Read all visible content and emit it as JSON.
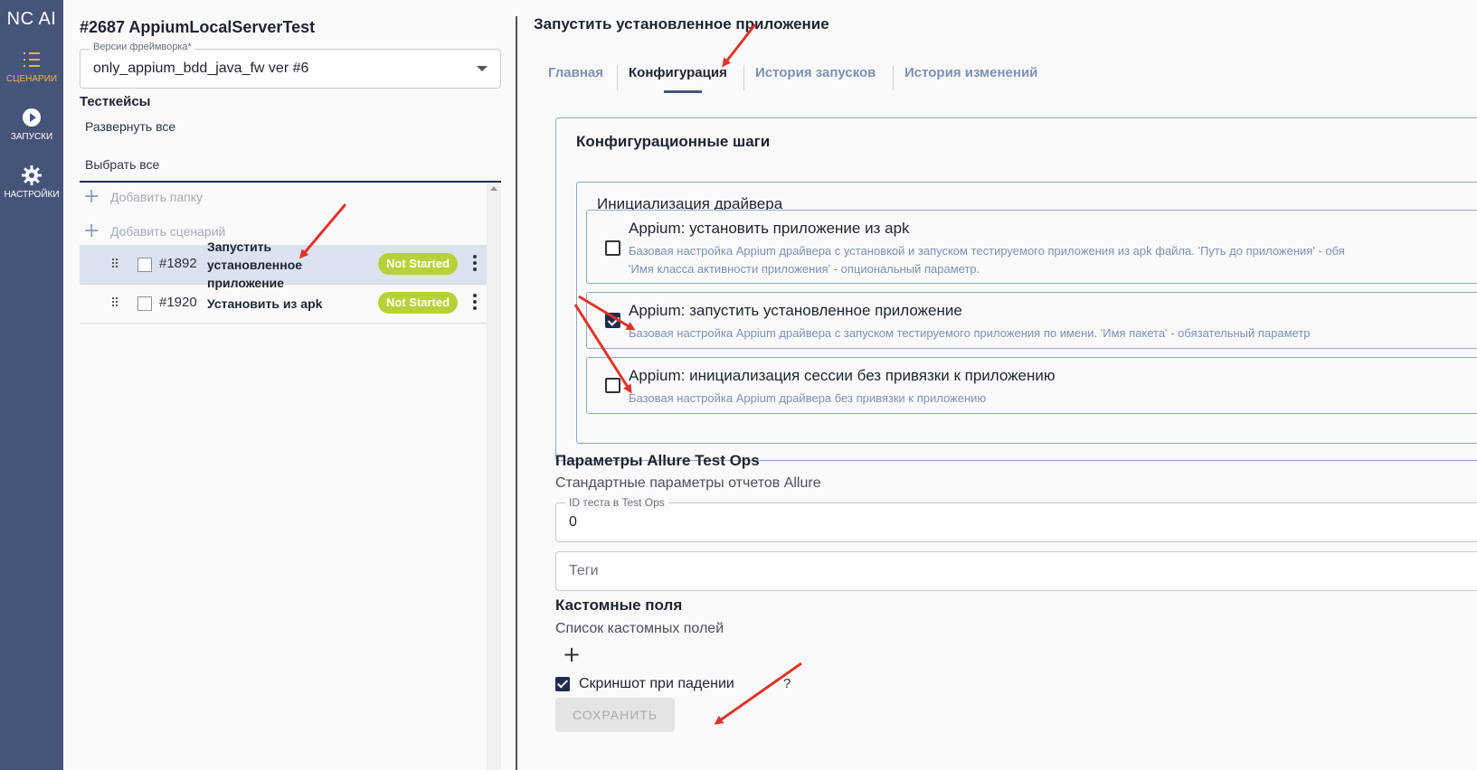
{
  "app": {
    "logo": "NC AI"
  },
  "nav": [
    {
      "label": "СЦЕНАРИИ",
      "icon": "list-icon",
      "active": true
    },
    {
      "label": "ЗАПУСКИ",
      "icon": "play-circle-icon",
      "active": false
    },
    {
      "label": "НАСТРОЙКИ",
      "icon": "gear-icon",
      "active": false
    }
  ],
  "left": {
    "project_title": "#2687 AppiumLocalServerTest",
    "framework": {
      "legend": "Версии фреймворка*",
      "value": "only_appium_bdd_java_fw ver #6"
    },
    "testcases_heading": "Тесткейсы",
    "expand_all": "Развернуть все",
    "select_all": "Выбрать все",
    "add_folder": "Добавить папку",
    "add_scenario": "Добавить сценарий",
    "testcases": [
      {
        "id": "#1892",
        "name": "Запустить установленное приложение",
        "status": "Not Started",
        "selected": true
      },
      {
        "id": "#1920",
        "name": "Установить из apk",
        "status": "Not Started",
        "selected": false
      }
    ]
  },
  "right": {
    "title": "Запустить установленное приложение",
    "tabs": [
      {
        "label": "Главная",
        "active": false
      },
      {
        "label": "Конфигурация",
        "active": true
      },
      {
        "label": "История запусков",
        "active": false
      },
      {
        "label": "История изменений",
        "active": false
      }
    ],
    "config_title": "Конфигурационные шаги",
    "init_title": "Инициализация драйвера",
    "options": [
      {
        "title": "Appium: установить приложение из apk",
        "desc1": "Базовая настройка Appium драйвера с установкой и запуском тестируемого приложения из apk файла. 'Путь до приложения' - обя",
        "desc2": "'Имя класса активности приложения' - опциональный параметр.",
        "checked": false
      },
      {
        "title": "Appium: запустить установленное приложение",
        "desc1": "Базовая настройка Appium драйвера с запуском тестируемого приложения по имени. 'Имя пакета' - обязательный параметр",
        "desc2": "",
        "checked": true
      },
      {
        "title": "Appium: инициализация сессии без привязки к приложению",
        "desc1": "Базовая настройка Appium драйвера без привязки к приложению",
        "desc2": "",
        "checked": false
      }
    ],
    "allure": {
      "heading": "Параметры Allure Test Ops",
      "sub": "Стандартные параметры отчетов Allure",
      "test_id_legend": "ID теста в Test Ops",
      "test_id_value": "0",
      "tags_placeholder": "Теги"
    },
    "custom": {
      "heading": "Кастомные поля",
      "sub": "Список кастомных полей"
    },
    "screenshot_label": "Скриншот при падении",
    "help": "?",
    "save_label": "СОХРАНИТЬ"
  },
  "colors": {
    "sidebar": "#475479",
    "accent": "#e8b44a",
    "badge": "#b6d23a",
    "arrow": "#e0332b",
    "border": "#8da7cf"
  }
}
